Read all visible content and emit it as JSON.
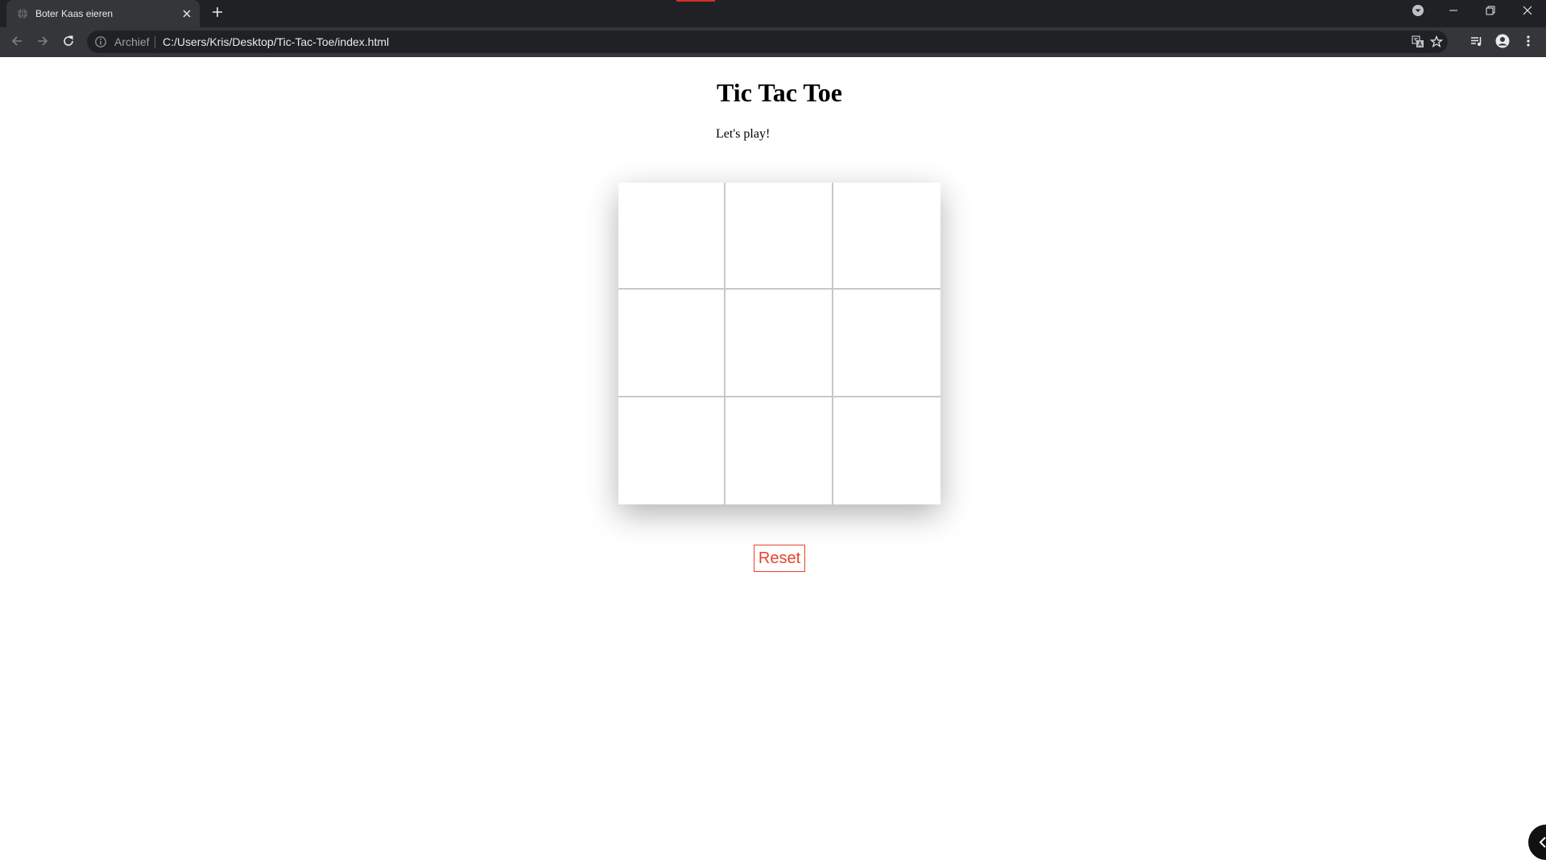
{
  "browser": {
    "tab": {
      "title": "Boter Kaas eieren",
      "favicon": "globe-icon",
      "close_icon": "close-icon"
    },
    "new_tab_icon": "plus-icon",
    "window_controls": [
      "tab-search-icon",
      "minimize-icon",
      "restore-icon",
      "close-icon"
    ],
    "toolbar": {
      "nav_icons": [
        "back-arrow-icon",
        "forward-arrow-icon",
        "reload-icon"
      ],
      "address": {
        "scheme_label": "Archief",
        "url": "C:/Users/Kris/Desktop/Tic-Tac-Toe/index.html"
      },
      "right_icons": [
        "translate-icon",
        "bookmark-star-icon",
        "media-queue-icon",
        "profile-icon",
        "menu-dots-icon"
      ]
    },
    "colors": {
      "tabstrip": "#202124",
      "toolbar": "#35363a",
      "accent": "#d93025"
    }
  },
  "page": {
    "title": "Tic Tac Toe",
    "subtitle": "Let's play!",
    "board": {
      "cells": [
        "",
        "",
        "",
        "",
        "",
        "",
        "",
        "",
        ""
      ]
    },
    "reset_label": "Reset",
    "colors": {
      "reset": "#e8432b",
      "grid_line": "#c8c8c8"
    }
  }
}
